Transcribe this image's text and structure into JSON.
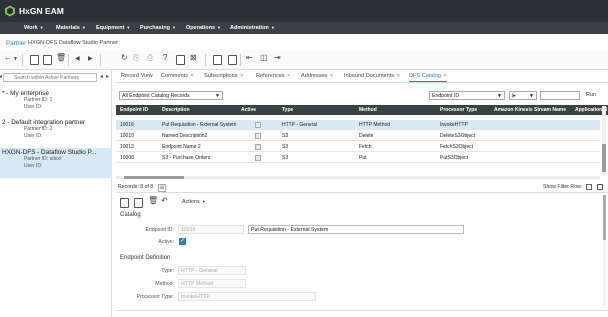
{
  "app": {
    "name": "HxGN EAM"
  },
  "menu": [
    {
      "label": "Work"
    },
    {
      "label": "Materials"
    },
    {
      "label": "Equipment"
    },
    {
      "label": "Purchasing"
    },
    {
      "label": "Operations"
    },
    {
      "label": "Administration"
    }
  ],
  "title": {
    "screen": "Partner",
    "record": "HXGN-DFS  Dataflow Studio Partner"
  },
  "left": {
    "search_placeholder": "Search within Active Partners",
    "partners": [
      {
        "name": "* - My enterprise",
        "id_label": "Partner ID:  1",
        "user_label": "User ID:"
      },
      {
        "name": "2 - Default integration partner",
        "id_label": "Partner ID:  2",
        "user_label": "User ID:"
      },
      {
        "name": "HXGN-DFS - Dataflow Studio P...",
        "id_label": "Partner ID:  iobox",
        "user_label": "User ID:"
      }
    ]
  },
  "tabs": [
    {
      "label": "Record View",
      "closable": false
    },
    {
      "label": "Comments",
      "closable": true
    },
    {
      "label": "Subscriptions",
      "closable": true
    },
    {
      "label": "References",
      "closable": true
    },
    {
      "label": "Addresses",
      "closable": true
    },
    {
      "label": "Inbound Documents",
      "closable": true
    },
    {
      "label": "DFS Catalog",
      "closable": true
    }
  ],
  "filter": {
    "dataspy": "All Endpoint Catalog Records",
    "field": "Endpoint ID",
    "operator": "|▸",
    "value": "",
    "run_label": "Run"
  },
  "grid": {
    "columns": [
      "Endpoint ID",
      "Description",
      "Active",
      "Type",
      "Method",
      "Processor Type",
      "Amazon Kinesis Stream Name",
      "Application N"
    ],
    "rows": [
      {
        "id": "10016",
        "desc": "Put Requisition - External System",
        "type": "HTTP - General",
        "method": "HTTP Method",
        "proc": "InvokeHTTP"
      },
      {
        "id": "10010",
        "desc": "Named Description2",
        "type": "S3",
        "method": "Delete",
        "proc": "DeleteS3Object"
      },
      {
        "id": "10013",
        "desc": "Endpoint Name 2",
        "type": "S3",
        "method": "Fetch",
        "proc": "FetchS3Object"
      },
      {
        "id": "10008",
        "desc": "S3 - Purchase Orders",
        "type": "S3",
        "method": "Put",
        "proc": "PutS3Object"
      }
    ]
  },
  "records_label": "Records: 8 of 8",
  "show_filter_label": "Show Filter Row:",
  "details": {
    "actions_label": "Actions",
    "catalog_section": "Catalog",
    "endpoint_id_label": "Endpoint ID:",
    "endpoint_id_value": "10016",
    "description_value": "Put Requisition - External System",
    "active_label": "Active:",
    "definition_section": "Endpoint Definition",
    "type_label": "Type:",
    "type_value": "HTTP - General",
    "method_label": "Method:",
    "method_value": "HTTP Method",
    "processor_label": "Processor Type:",
    "processor_value": "InvokeHTTP"
  },
  "colors": {
    "topbar": "#2b3236",
    "accent": "#2f7fb8",
    "selected_row": "#d7e9f5",
    "grid_header": "#3a4145"
  }
}
